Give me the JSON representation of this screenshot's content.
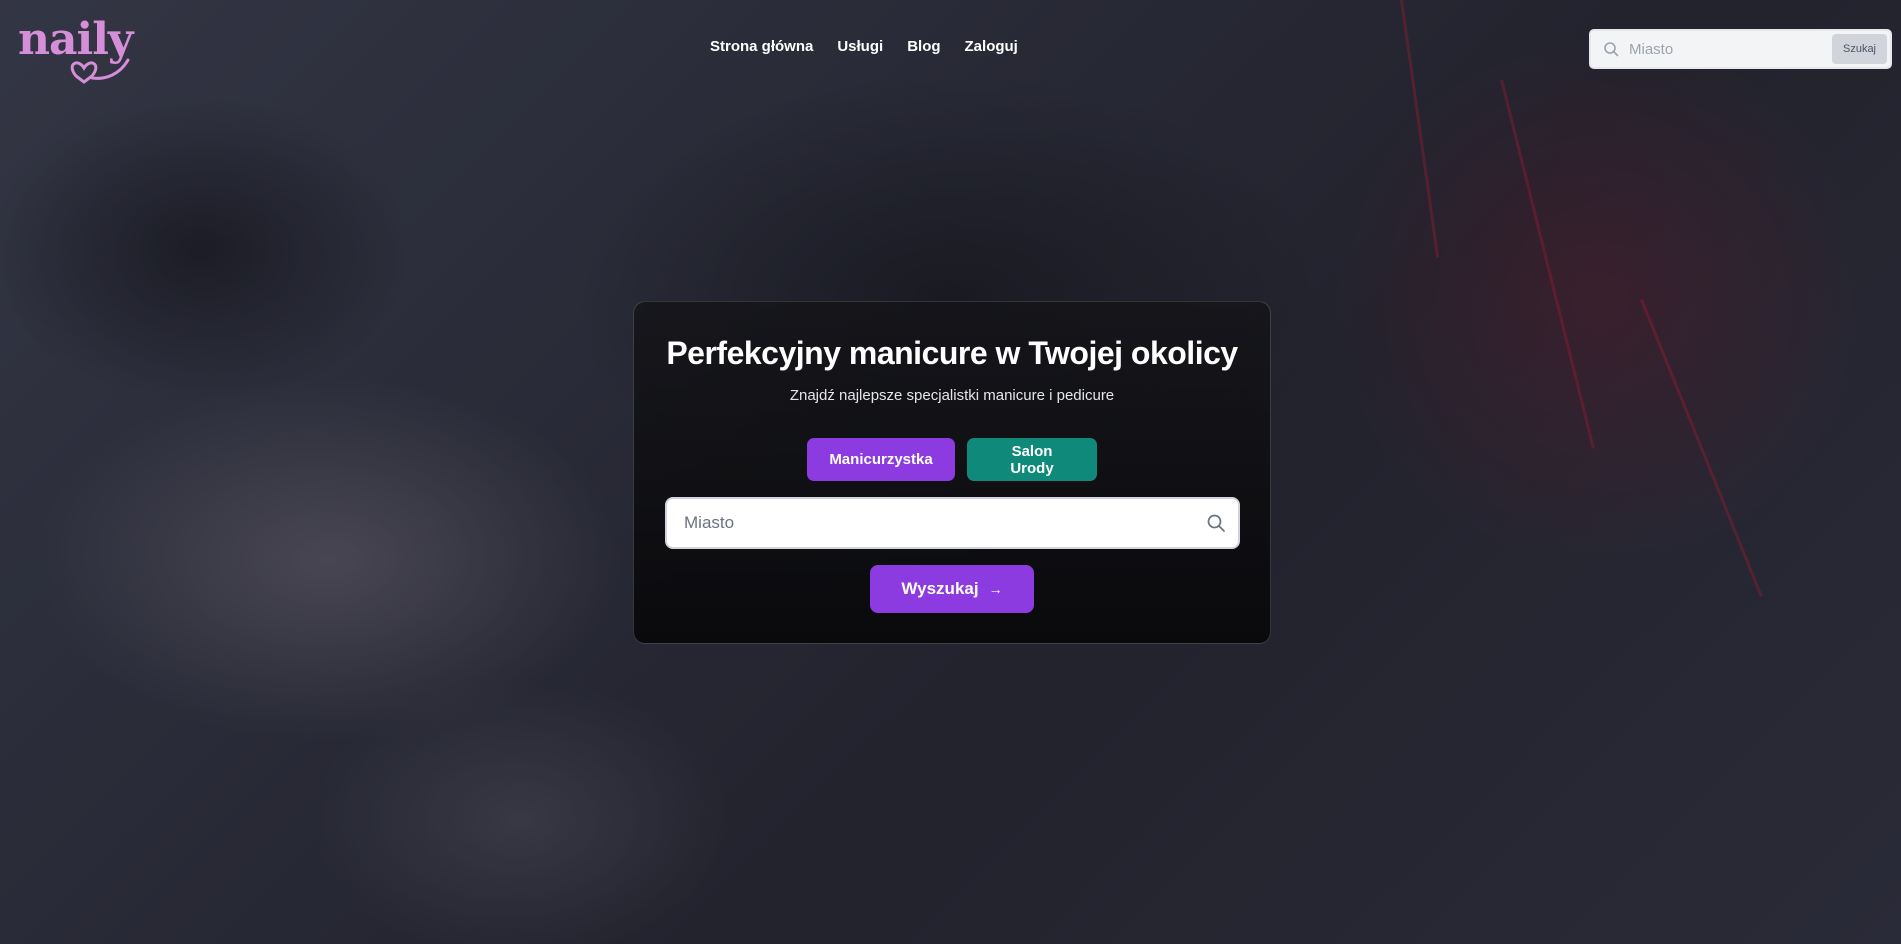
{
  "brand": {
    "logo_text": "naily"
  },
  "nav": {
    "items": [
      {
        "label": "Strona główna"
      },
      {
        "label": "Usługi"
      },
      {
        "label": "Blog"
      },
      {
        "label": "Zaloguj"
      }
    ]
  },
  "header_search": {
    "placeholder": "Miasto",
    "value": "",
    "button_label": "Szukaj",
    "icon": "search-icon"
  },
  "hero": {
    "title": "Perfekcyjny manicure w Twojej okolicy",
    "subtitle": "Znajdź najlepsze specjalistki manicure i pedicure",
    "type_buttons": [
      {
        "label": "Manicurzystka",
        "color": "#8b3bdf"
      },
      {
        "label": "Salon Urody",
        "color": "#0f8a7a"
      }
    ],
    "search": {
      "placeholder": "Miasto",
      "value": "",
      "icon": "search-icon"
    },
    "submit": {
      "label": "Wyszukaj",
      "icon": "arrow-right-icon"
    }
  },
  "colors": {
    "accent": "#8b3bdf",
    "teal": "#0f8a7a",
    "logo": "#d48fd8"
  }
}
